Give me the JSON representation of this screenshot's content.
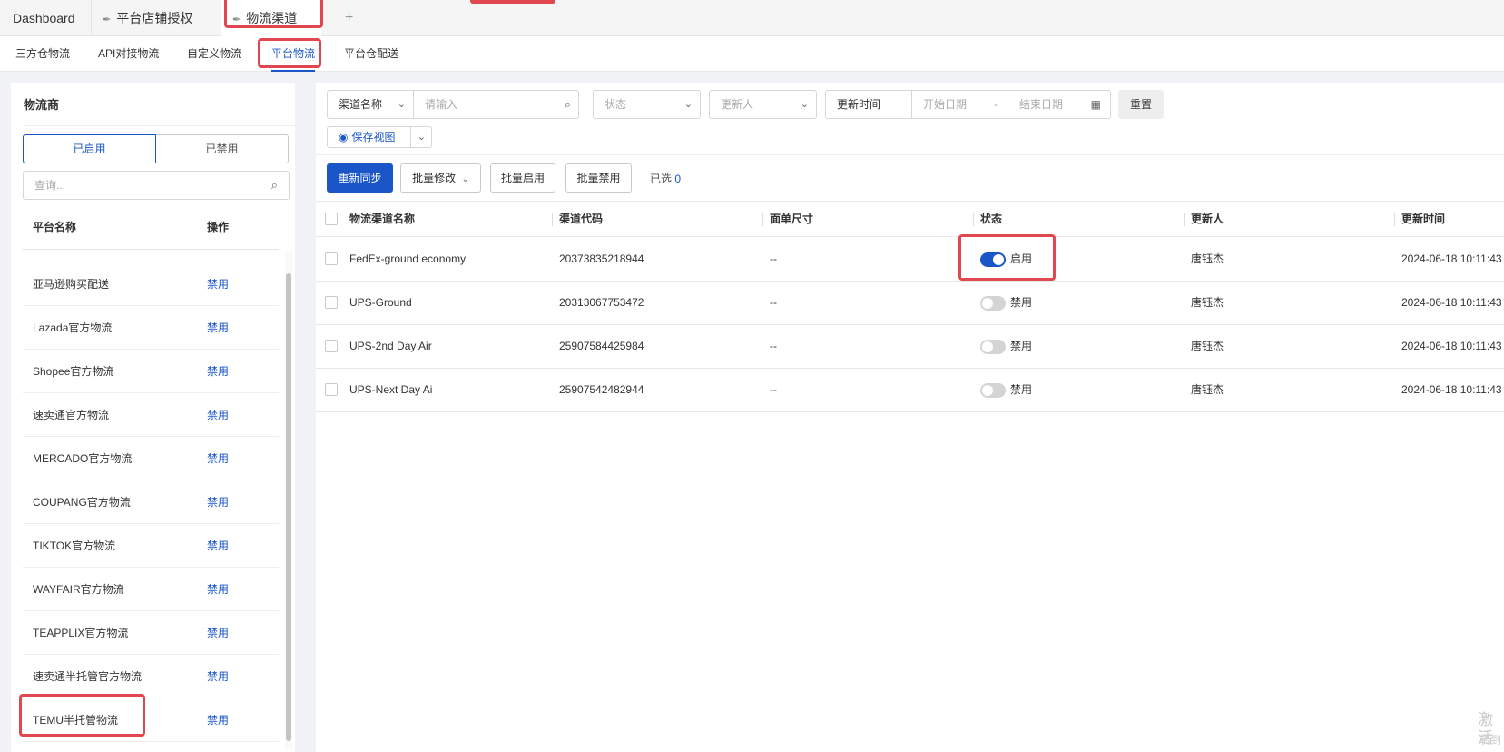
{
  "tabs": {
    "dashboard": "Dashboard",
    "store_auth": "平台店铺授权",
    "channel": "物流渠道",
    "add": "+"
  },
  "subtabs": [
    "三方仓物流",
    "API对接物流",
    "自定义物流",
    "平台物流",
    "平台仓配送"
  ],
  "active_subtab": "平台物流",
  "left": {
    "title": "物流商",
    "seg_enabled": "已启用",
    "seg_disabled": "已禁用",
    "search_placeholder": "查询...",
    "col_name": "平台名称",
    "col_op": "操作",
    "rows": [
      {
        "name": "亚马逊购买配送",
        "op": "禁用"
      },
      {
        "name": "Lazada官方物流",
        "op": "禁用"
      },
      {
        "name": "Shopee官方物流",
        "op": "禁用"
      },
      {
        "name": "速卖通官方物流",
        "op": "禁用"
      },
      {
        "name": "MERCADO官方物流",
        "op": "禁用"
      },
      {
        "name": "COUPANG官方物流",
        "op": "禁用"
      },
      {
        "name": "TIKTOK官方物流",
        "op": "禁用"
      },
      {
        "name": "WAYFAIR官方物流",
        "op": "禁用"
      },
      {
        "name": "TEAPPLIX官方物流",
        "op": "禁用"
      },
      {
        "name": "速卖通半托管官方物流",
        "op": "禁用"
      },
      {
        "name": "TEMU半托管物流",
        "op": "禁用"
      }
    ]
  },
  "filters": {
    "channel_name_select": "渠道名称",
    "keyword_placeholder": "请输入",
    "status_placeholder": "状态",
    "updater_placeholder": "更新人",
    "update_time_label": "更新时间",
    "start_date_placeholder": "开始日期",
    "date_sep": "-",
    "end_date_placeholder": "结束日期",
    "reset": "重置",
    "save_view": "保存视图"
  },
  "actions": {
    "resync": "重新同步",
    "batch_edit": "批量修改",
    "batch_enable": "批量启用",
    "batch_disable": "批量禁用",
    "selected_label": "已选",
    "selected_count": "0"
  },
  "table": {
    "headers": [
      "物流渠道名称",
      "渠道代码",
      "面单尺寸",
      "状态",
      "更新人",
      "更新时间"
    ],
    "rows": [
      {
        "name": "FedEx-ground economy",
        "code": "20373835218944",
        "size": "--",
        "status": "启用",
        "enabled": true,
        "updater": "唐钰杰",
        "time": "2024-06-18 10:11:43"
      },
      {
        "name": "UPS-Ground",
        "code": "20313067753472",
        "size": "--",
        "status": "禁用",
        "enabled": false,
        "updater": "唐钰杰",
        "time": "2024-06-18 10:11:43"
      },
      {
        "name": "UPS-2nd Day Air",
        "code": "25907584425984",
        "size": "--",
        "status": "禁用",
        "enabled": false,
        "updater": "唐钰杰",
        "time": "2024-06-18 10:11:43"
      },
      {
        "name": "UPS-Next Day Ai",
        "code": "25907542482944",
        "size": "--",
        "status": "禁用",
        "enabled": false,
        "updater": "唐钰杰",
        "time": "2024-06-18 10:11:43"
      }
    ]
  },
  "watermark": {
    "line1": "激活",
    "line2": "转到"
  },
  "colors": {
    "accent": "#1a56c8",
    "highlight": "#e0474f"
  }
}
